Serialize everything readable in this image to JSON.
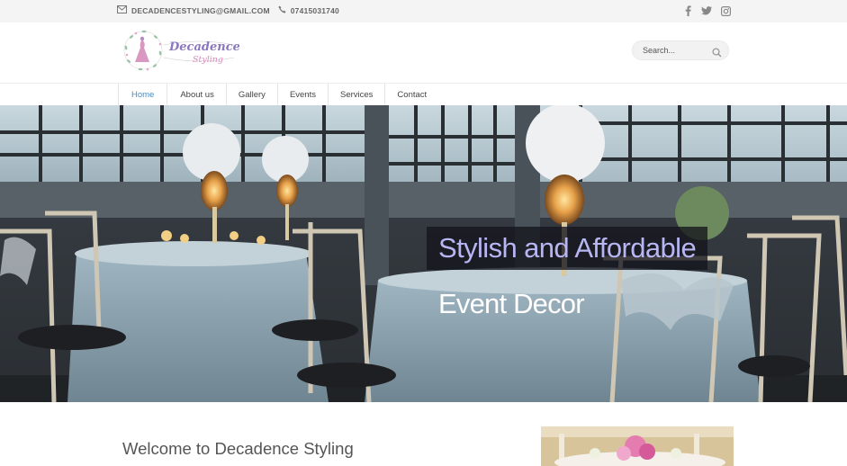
{
  "topbar": {
    "email": "DECADENCESTYLING@GMAIL.COM",
    "phone": "07415031740",
    "email_icon": "envelope-icon",
    "phone_icon": "phone-icon",
    "social": [
      "facebook-icon",
      "twitter-icon",
      "instagram-icon"
    ]
  },
  "header": {
    "logo_line1": "Decadence",
    "logo_line2": "Styling",
    "search_placeholder": "Search...",
    "search_icon": "magnifier-icon"
  },
  "nav": {
    "items": [
      {
        "label": "Home",
        "active": true
      },
      {
        "label": "About us",
        "active": false
      },
      {
        "label": "Gallery",
        "active": false
      },
      {
        "label": "Events",
        "active": false
      },
      {
        "label": "Services",
        "active": false
      },
      {
        "label": "Contact",
        "active": false
      }
    ]
  },
  "hero": {
    "headline": "Stylish and Affordable",
    "subline": "Event Decor"
  },
  "main": {
    "welcome_title": "Welcome to Decadence Styling"
  },
  "colors": {
    "accent": "#3e8fcf",
    "headline_text": "#b7b6f2",
    "topbar_bg": "#f4f4f4",
    "logo_pink": "#d98bbd",
    "logo_purple": "#8a78bd"
  }
}
